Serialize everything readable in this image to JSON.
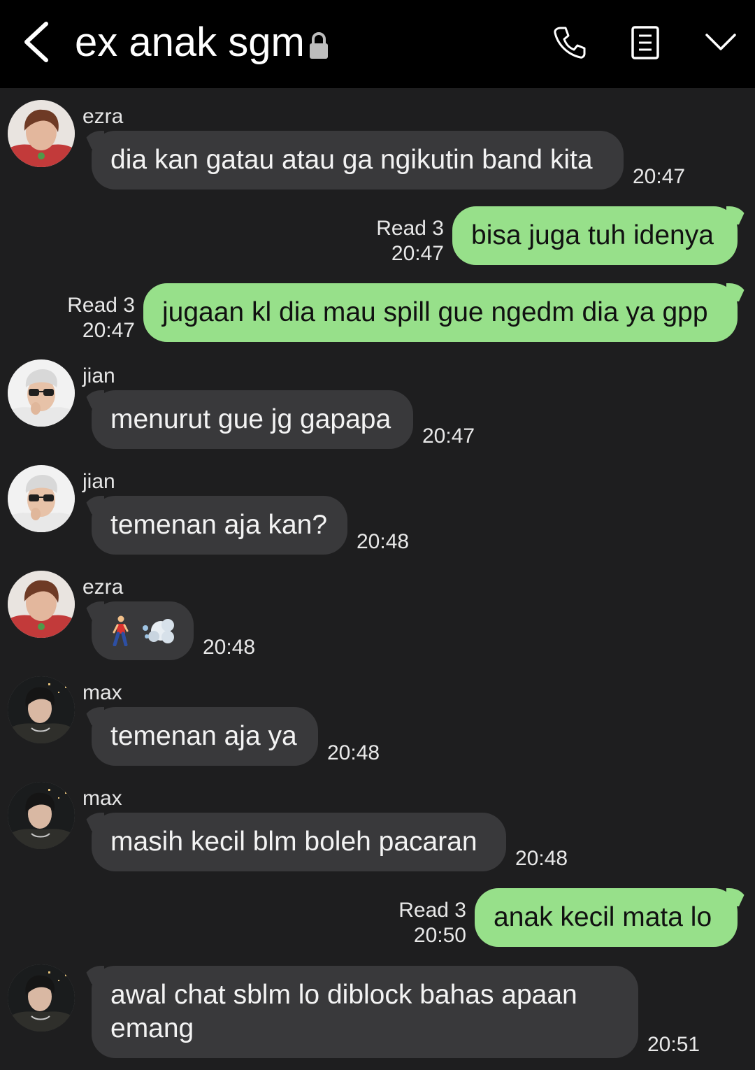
{
  "header": {
    "title": "ex anak sgm",
    "back_icon": "chevron-left-icon",
    "lock_icon": "lock-icon",
    "actions": [
      "phone-icon",
      "notes-icon",
      "chevron-down-icon"
    ]
  },
  "colors": {
    "header_bg": "#000000",
    "chat_bg": "#1e1e1f",
    "incoming_bubble": "#39393b",
    "outgoing_bubble": "#97e08a"
  },
  "messages": [
    {
      "direction": "in",
      "sender": "ezra",
      "text": "dia kan gatau atau ga ngikutin band kita",
      "time": "20:47"
    },
    {
      "direction": "out",
      "read": "Read 3",
      "text": "bisa juga tuh idenya",
      "time": "20:47"
    },
    {
      "direction": "out",
      "read": "Read 3",
      "text": "jugaan kl dia mau spill gue ngedm dia ya gpp",
      "time": "20:47"
    },
    {
      "direction": "in",
      "sender": "jian",
      "text": "menurut gue jg gapapa",
      "time": "20:47"
    },
    {
      "direction": "in",
      "sender": "jian",
      "text": "temenan aja kan?",
      "time": "20:48"
    },
    {
      "direction": "in",
      "sender": "ezra",
      "emoji": [
        "person-walking-emoji",
        "dash-emoji"
      ],
      "time": "20:48"
    },
    {
      "direction": "in",
      "sender": "max",
      "text": "temenan aja ya",
      "time": "20:48"
    },
    {
      "direction": "in",
      "sender": "max",
      "text": "masih kecil blm boleh pacaran",
      "time": "20:48"
    },
    {
      "direction": "out",
      "read": "Read 3",
      "text": "anak kecil mata lo",
      "time": "20:50"
    },
    {
      "direction": "in",
      "text_line1": "awal chat sblm lo diblock bahas apaan",
      "text_line2": "emang",
      "time": "20:51"
    }
  ]
}
